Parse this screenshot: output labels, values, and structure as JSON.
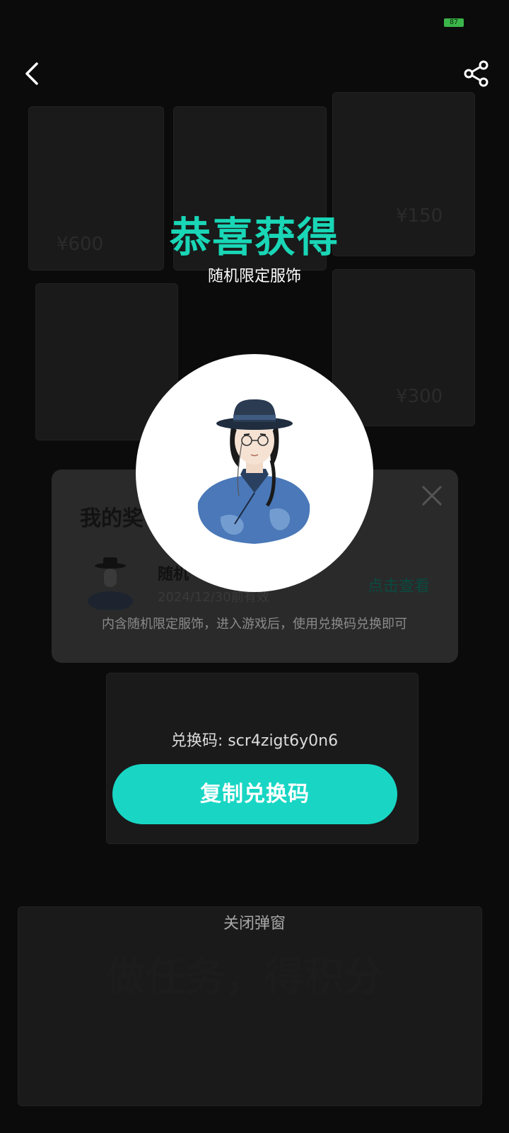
{
  "status": {
    "battery": "87"
  },
  "popup": {
    "title": "恭喜获得",
    "subtitle": "随机限定服饰",
    "code_prefix": "兑换码: ",
    "code": "scr4zigt6y0n6",
    "copy_button": "复制兑换码",
    "close_label": "关闭弹窗"
  },
  "reward_panel": {
    "title": "我的奖",
    "item_name": "随机",
    "item_expiry": "2024/12/30前有效",
    "view_label": "点击查看",
    "description": "内含随机限定服饰，进入游戏后，使用兑换码兑换即可"
  },
  "background_texts": {
    "big_slogan": "做任务，得积分",
    "price_1": "¥600",
    "price_2": "¥150",
    "price_3": "¥300"
  },
  "colors": {
    "accent": "#19d6b6",
    "button": "#19d6c4"
  },
  "icons": {
    "back": "chevron-left-icon",
    "share": "share-icon",
    "close": "close-icon"
  }
}
